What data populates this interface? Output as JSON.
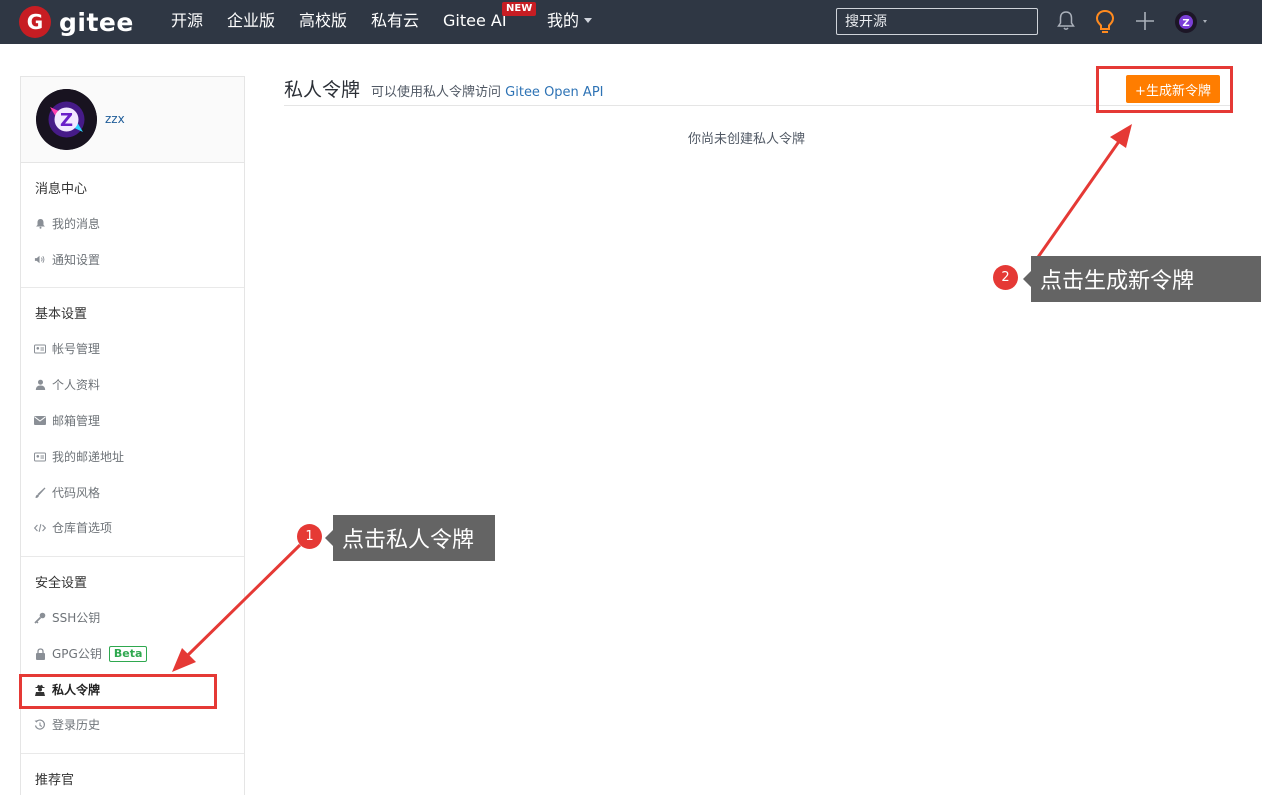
{
  "brand": {
    "logo_letter": "G",
    "name": "gitee"
  },
  "nav": {
    "items": [
      "开源",
      "企业版",
      "高校版",
      "私有云",
      "Gitee AI",
      "我的"
    ],
    "ai_badge": "NEW",
    "search_placeholder": "搜开源",
    "icons": [
      "bell-icon",
      "lightbulb-icon",
      "plus-icon",
      "user-avatar"
    ]
  },
  "profile": {
    "username": "zzx",
    "avatar_letter": "Z"
  },
  "sidebar": {
    "sections": [
      {
        "title": "消息中心",
        "items": [
          {
            "label": "我的消息",
            "icon": "bell-icon"
          },
          {
            "label": "通知设置",
            "icon": "volume-icon"
          }
        ]
      },
      {
        "title": "基本设置",
        "items": [
          {
            "label": "帐号管理",
            "icon": "id-card-icon"
          },
          {
            "label": "个人资料",
            "icon": "user-icon"
          },
          {
            "label": "邮箱管理",
            "icon": "envelope-icon"
          },
          {
            "label": "我的邮递地址",
            "icon": "address-card-icon"
          },
          {
            "label": "代码风格",
            "icon": "brush-icon"
          },
          {
            "label": "仓库首选项",
            "icon": "code-icon"
          }
        ]
      },
      {
        "title": "安全设置",
        "items": [
          {
            "label": "SSH公钥",
            "icon": "key-icon"
          },
          {
            "label": "GPG公钥",
            "icon": "lock-icon",
            "badge": "Beta"
          },
          {
            "label": "私人令牌",
            "icon": "user-secret-icon",
            "active": true
          },
          {
            "label": "登录历史",
            "icon": "history-icon"
          }
        ]
      },
      {
        "title": "推荐官",
        "items": []
      }
    ]
  },
  "main": {
    "title": "私人令牌",
    "subtitle_prefix": "可以使用私人令牌访问",
    "subtitle_link": "Gitee Open API",
    "generate_button": "+生成新令牌",
    "empty_text": "你尚未创建私人令牌"
  },
  "annotations": {
    "step1": {
      "number": "1",
      "text": "点击私人令牌"
    },
    "step2": {
      "number": "2",
      "text": "点击生成新令牌"
    },
    "color": "#e53935"
  },
  "colors": {
    "nav_bg": "#2f3744",
    "brand": "#c71d23",
    "primary_button": "#ff7d00",
    "link": "#2e73b5"
  }
}
